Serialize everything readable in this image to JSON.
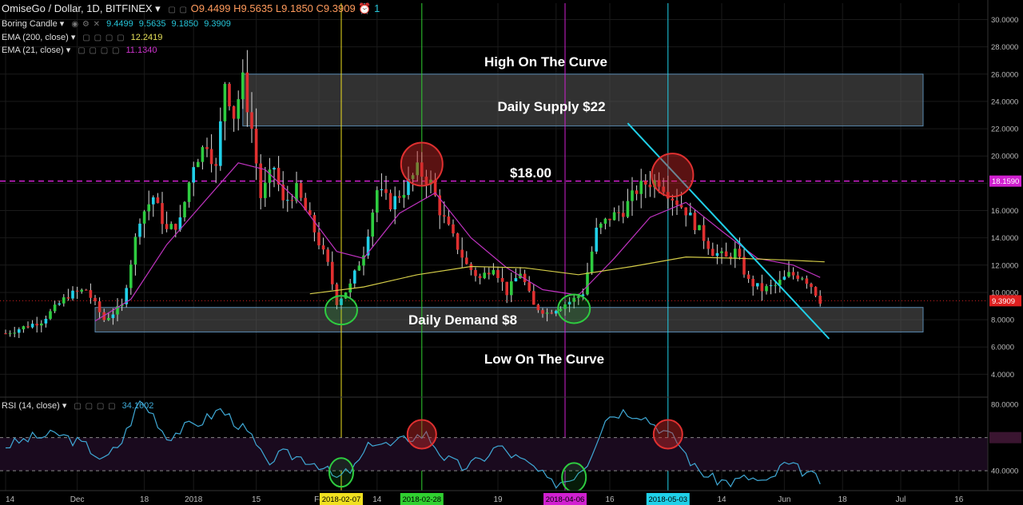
{
  "header": {
    "symbol": "OmiseGo / Dollar, 1D, BITFINEX",
    "open": "O9.4499",
    "high": "H9.5635",
    "low": "L9.1850",
    "close": "C9.3909",
    "alerts": "1"
  },
  "indicators": [
    {
      "label": "Boring Candle",
      "values": [
        "9.4499",
        "9.5635",
        "9.1850",
        "9.3909"
      ],
      "color": "#26c6da"
    },
    {
      "label": "EMA (200, close)",
      "values": [
        "12.2419"
      ],
      "color": "#e6e05a"
    },
    {
      "label": "EMA (21, close)",
      "values": [
        "11.1340"
      ],
      "color": "#cc33cc"
    }
  ],
  "rsi": {
    "label": "RSI (14, close)",
    "value": "34.1602",
    "color": "#3fa9d6"
  },
  "annotations": {
    "high_curve": "High On The Curve",
    "supply": "Daily Supply $22",
    "level": "$18.00",
    "demand": "Daily Demand $8",
    "low_curve": "Low On The Curve"
  },
  "colors": {
    "up": "#2ecc40",
    "down": "#e03030",
    "cyan": "#20d0e8",
    "ema200": "#d4cc48",
    "ema21": "#c033c0",
    "rsi": "#3fa9d6",
    "level": "#d020d0"
  },
  "chart_data": {
    "type": "line",
    "symbol": "OmiseGo / Dollar, 1D, BITFINEX",
    "price_axis": {
      "ylim": [
        2.5,
        31.2
      ],
      "ticks": [
        "30.0000",
        "28.0000",
        "26.0000",
        "24.0000",
        "22.0000",
        "20.0000",
        "18.0000",
        "16.0000",
        "14.0000",
        "12.0000",
        "10.0000",
        "8.0000",
        "6.0000",
        "4.0000"
      ],
      "tick_values": [
        30,
        28,
        26,
        24,
        22,
        20,
        18,
        16,
        14,
        12,
        10,
        8,
        6,
        4
      ],
      "last_price_label": "9.3909",
      "last_price": 9.3909,
      "level_label": "18.1590",
      "level": 18.159
    },
    "rsi_axis": {
      "ylim": [
        28,
        83
      ],
      "ticks": [
        "80.0000",
        "60.0000",
        "40.0000"
      ],
      "tick_values": [
        80,
        60,
        40
      ],
      "overbought": 60,
      "oversold": 40
    },
    "x_ticks": [
      "14",
      "Dec",
      "18",
      "2018",
      "15",
      "Fe",
      "14",
      "19",
      "A",
      "16",
      "14",
      "Jun",
      "18",
      "Jul",
      "16"
    ],
    "x_tick_index": [
      0,
      16,
      31,
      42,
      56,
      70,
      83,
      110,
      123,
      135,
      160,
      174,
      187,
      200,
      213
    ],
    "date_markers": [
      {
        "label": "2018-02-07",
        "index": 75,
        "color": "#f0e020"
      },
      {
        "label": "2018-02-28",
        "index": 93,
        "color": "#30d030"
      },
      {
        "label": "2018-04-06",
        "index": 125,
        "color": "#d020d0"
      },
      {
        "label": "2018-05-03",
        "index": 148,
        "color": "#20d0e8"
      }
    ],
    "zones": [
      {
        "name": "supply",
        "y0": 22.2,
        "y1": 26.0,
        "x0_index": 53,
        "x1_index": 205
      },
      {
        "name": "demand",
        "y0": 7.1,
        "y1": 8.9,
        "x0_index": 20,
        "x1_index": 205
      }
    ],
    "trendline": {
      "x0_index": 139,
      "y0": 22.4,
      "x1_index": 184,
      "y1": 6.6
    },
    "anchors": [
      {
        "i": 0,
        "p": 7.0
      },
      {
        "i": 8,
        "p": 7.9
      },
      {
        "i": 14,
        "p": 9.8
      },
      {
        "i": 18,
        "p": 10.2
      },
      {
        "i": 22,
        "p": 8.0
      },
      {
        "i": 26,
        "p": 9.0
      },
      {
        "i": 30,
        "p": 15.5
      },
      {
        "i": 33,
        "p": 17.0
      },
      {
        "i": 36,
        "p": 14.5
      },
      {
        "i": 39,
        "p": 15.2
      },
      {
        "i": 42,
        "p": 19.5
      },
      {
        "i": 45,
        "p": 21.0
      },
      {
        "i": 47,
        "p": 19.0
      },
      {
        "i": 49,
        "p": 25.5
      },
      {
        "i": 51,
        "p": 23.0
      },
      {
        "i": 53,
        "p": 25.5
      },
      {
        "i": 55,
        "p": 22.0
      },
      {
        "i": 57,
        "p": 17.0
      },
      {
        "i": 60,
        "p": 19.2
      },
      {
        "i": 62,
        "p": 16.5
      },
      {
        "i": 65,
        "p": 17.5
      },
      {
        "i": 69,
        "p": 14.5
      },
      {
        "i": 72,
        "p": 12.0
      },
      {
        "i": 74,
        "p": 9.3
      },
      {
        "i": 77,
        "p": 10.5
      },
      {
        "i": 80,
        "p": 13.0
      },
      {
        "i": 83,
        "p": 17.5
      },
      {
        "i": 86,
        "p": 16.5
      },
      {
        "i": 89,
        "p": 17.5
      },
      {
        "i": 92,
        "p": 19.0
      },
      {
        "i": 95,
        "p": 18.0
      },
      {
        "i": 97,
        "p": 16.0
      },
      {
        "i": 100,
        "p": 14.0
      },
      {
        "i": 103,
        "p": 12.0
      },
      {
        "i": 106,
        "p": 11.0
      },
      {
        "i": 109,
        "p": 12.0
      },
      {
        "i": 112,
        "p": 10.0
      },
      {
        "i": 115,
        "p": 11.5
      },
      {
        "i": 118,
        "p": 9.0
      },
      {
        "i": 121,
        "p": 8.5
      },
      {
        "i": 124,
        "p": 9.0
      },
      {
        "i": 127,
        "p": 9.5
      },
      {
        "i": 129,
        "p": 10.0
      },
      {
        "i": 132,
        "p": 14.5
      },
      {
        "i": 135,
        "p": 15.5
      },
      {
        "i": 138,
        "p": 16.0
      },
      {
        "i": 141,
        "p": 17.5
      },
      {
        "i": 143,
        "p": 18.0
      },
      {
        "i": 146,
        "p": 18.2
      },
      {
        "i": 149,
        "p": 17.0
      },
      {
        "i": 152,
        "p": 16.0
      },
      {
        "i": 155,
        "p": 14.5
      },
      {
        "i": 158,
        "p": 13.0
      },
      {
        "i": 161,
        "p": 12.5
      },
      {
        "i": 163,
        "p": 13.0
      },
      {
        "i": 166,
        "p": 10.8
      },
      {
        "i": 169,
        "p": 10.2
      },
      {
        "i": 172,
        "p": 10.5
      },
      {
        "i": 175,
        "p": 11.3
      },
      {
        "i": 178,
        "p": 11.2
      },
      {
        "i": 180,
        "p": 10.5
      },
      {
        "i": 182,
        "p": 9.4
      }
    ],
    "ema21": [
      {
        "i": 20,
        "p": 7.9
      },
      {
        "i": 28,
        "p": 9.5
      },
      {
        "i": 36,
        "p": 13.5
      },
      {
        "i": 44,
        "p": 16.5
      },
      {
        "i": 52,
        "p": 19.5
      },
      {
        "i": 58,
        "p": 19.0
      },
      {
        "i": 66,
        "p": 16.5
      },
      {
        "i": 74,
        "p": 13.0
      },
      {
        "i": 80,
        "p": 12.5
      },
      {
        "i": 88,
        "p": 15.8
      },
      {
        "i": 96,
        "p": 17.3
      },
      {
        "i": 104,
        "p": 14.0
      },
      {
        "i": 112,
        "p": 11.8
      },
      {
        "i": 120,
        "p": 10.2
      },
      {
        "i": 128,
        "p": 9.8
      },
      {
        "i": 136,
        "p": 12.5
      },
      {
        "i": 144,
        "p": 15.5
      },
      {
        "i": 152,
        "p": 16.6
      },
      {
        "i": 160,
        "p": 14.5
      },
      {
        "i": 168,
        "p": 12.5
      },
      {
        "i": 176,
        "p": 12.0
      },
      {
        "i": 182,
        "p": 11.1
      }
    ],
    "ema200": [
      {
        "i": 68,
        "p": 9.9
      },
      {
        "i": 80,
        "p": 10.4
      },
      {
        "i": 92,
        "p": 11.3
      },
      {
        "i": 104,
        "p": 11.9
      },
      {
        "i": 116,
        "p": 11.8
      },
      {
        "i": 128,
        "p": 11.3
      },
      {
        "i": 140,
        "p": 11.9
      },
      {
        "i": 152,
        "p": 12.6
      },
      {
        "i": 164,
        "p": 12.5
      },
      {
        "i": 176,
        "p": 12.35
      },
      {
        "i": 183,
        "p": 12.24
      }
    ],
    "rsi_anchors": [
      {
        "i": 0,
        "p": 55
      },
      {
        "i": 6,
        "p": 60
      },
      {
        "i": 12,
        "p": 62
      },
      {
        "i": 18,
        "p": 55
      },
      {
        "i": 22,
        "p": 46
      },
      {
        "i": 26,
        "p": 58
      },
      {
        "i": 30,
        "p": 82
      },
      {
        "i": 33,
        "p": 74
      },
      {
        "i": 36,
        "p": 60
      },
      {
        "i": 40,
        "p": 66
      },
      {
        "i": 44,
        "p": 70
      },
      {
        "i": 48,
        "p": 77
      },
      {
        "i": 52,
        "p": 68
      },
      {
        "i": 55,
        "p": 60
      },
      {
        "i": 58,
        "p": 45
      },
      {
        "i": 62,
        "p": 50
      },
      {
        "i": 66,
        "p": 48
      },
      {
        "i": 70,
        "p": 44
      },
      {
        "i": 74,
        "p": 35
      },
      {
        "i": 78,
        "p": 42
      },
      {
        "i": 82,
        "p": 58
      },
      {
        "i": 86,
        "p": 55
      },
      {
        "i": 90,
        "p": 60
      },
      {
        "i": 94,
        "p": 62
      },
      {
        "i": 98,
        "p": 48
      },
      {
        "i": 102,
        "p": 42
      },
      {
        "i": 106,
        "p": 46
      },
      {
        "i": 110,
        "p": 55
      },
      {
        "i": 114,
        "p": 48
      },
      {
        "i": 118,
        "p": 42
      },
      {
        "i": 122,
        "p": 32
      },
      {
        "i": 126,
        "p": 35
      },
      {
        "i": 130,
        "p": 45
      },
      {
        "i": 134,
        "p": 72
      },
      {
        "i": 138,
        "p": 76
      },
      {
        "i": 142,
        "p": 74
      },
      {
        "i": 146,
        "p": 66
      },
      {
        "i": 150,
        "p": 58
      },
      {
        "i": 154,
        "p": 42
      },
      {
        "i": 158,
        "p": 35
      },
      {
        "i": 162,
        "p": 33
      },
      {
        "i": 166,
        "p": 36
      },
      {
        "i": 170,
        "p": 32
      },
      {
        "i": 174,
        "p": 44
      },
      {
        "i": 178,
        "p": 40
      },
      {
        "i": 182,
        "p": 34
      }
    ],
    "circles_price": [
      {
        "index": 75,
        "price": 8.7,
        "color": "#2ecc40"
      },
      {
        "index": 93,
        "price": 19.4,
        "color": "#e03030"
      },
      {
        "index": 127,
        "price": 8.8,
        "color": "#2ecc40"
      },
      {
        "index": 149,
        "price": 18.6,
        "color": "#e03030"
      }
    ],
    "circles_rsi": [
      {
        "index": 75,
        "value": 39,
        "color": "#2ecc40"
      },
      {
        "index": 93,
        "value": 62,
        "color": "#e03030"
      },
      {
        "index": 127,
        "value": 36,
        "color": "#2ecc40"
      },
      {
        "index": 148,
        "value": 62,
        "color": "#e03030"
      }
    ]
  }
}
